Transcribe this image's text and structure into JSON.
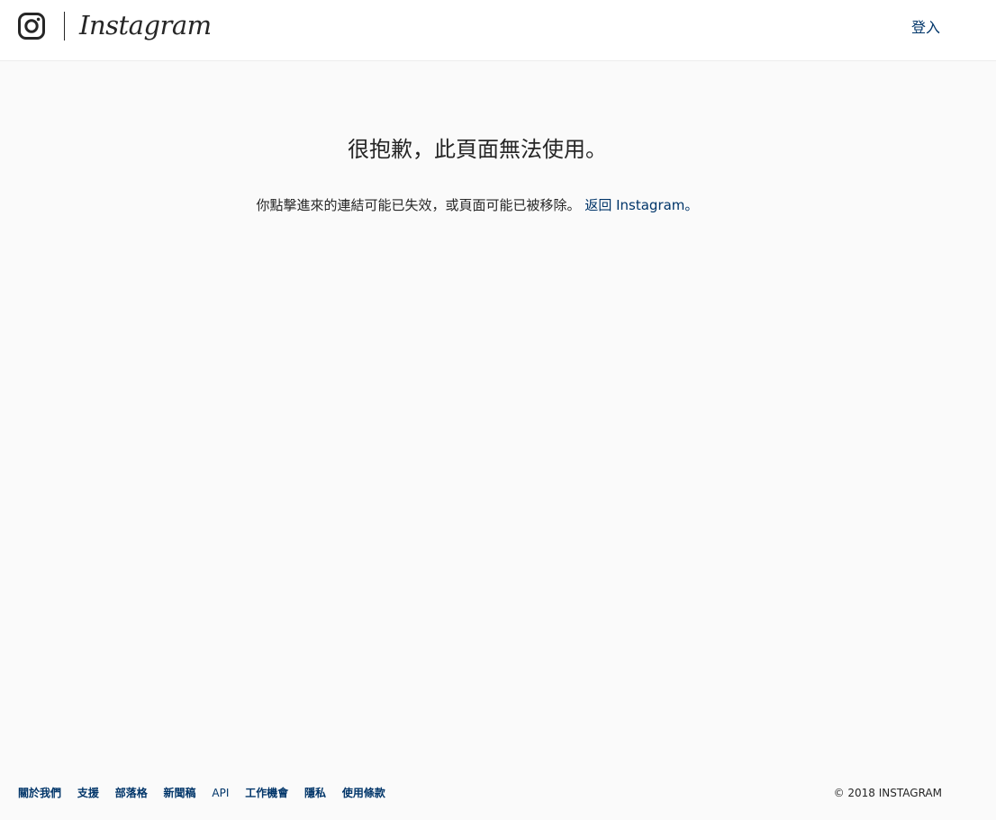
{
  "header": {
    "logo_icon": "instagram-camera-icon",
    "wordmark": "Instagram",
    "login_label": "登入"
  },
  "error": {
    "title": "很抱歉，此頁面無法使用。",
    "message": "你點擊進來的連結可能已失效，或頁面可能已被移除。",
    "back_link": "返回 Instagram。"
  },
  "footer": {
    "links": [
      "關於我們",
      "支援",
      "部落格",
      "新聞稿",
      "API",
      "工作機會",
      "隱私",
      "使用條款"
    ],
    "copyright": "© 2018 INSTAGRAM"
  },
  "colors": {
    "link": "#003569",
    "background": "#fafafa",
    "text": "#262626"
  }
}
